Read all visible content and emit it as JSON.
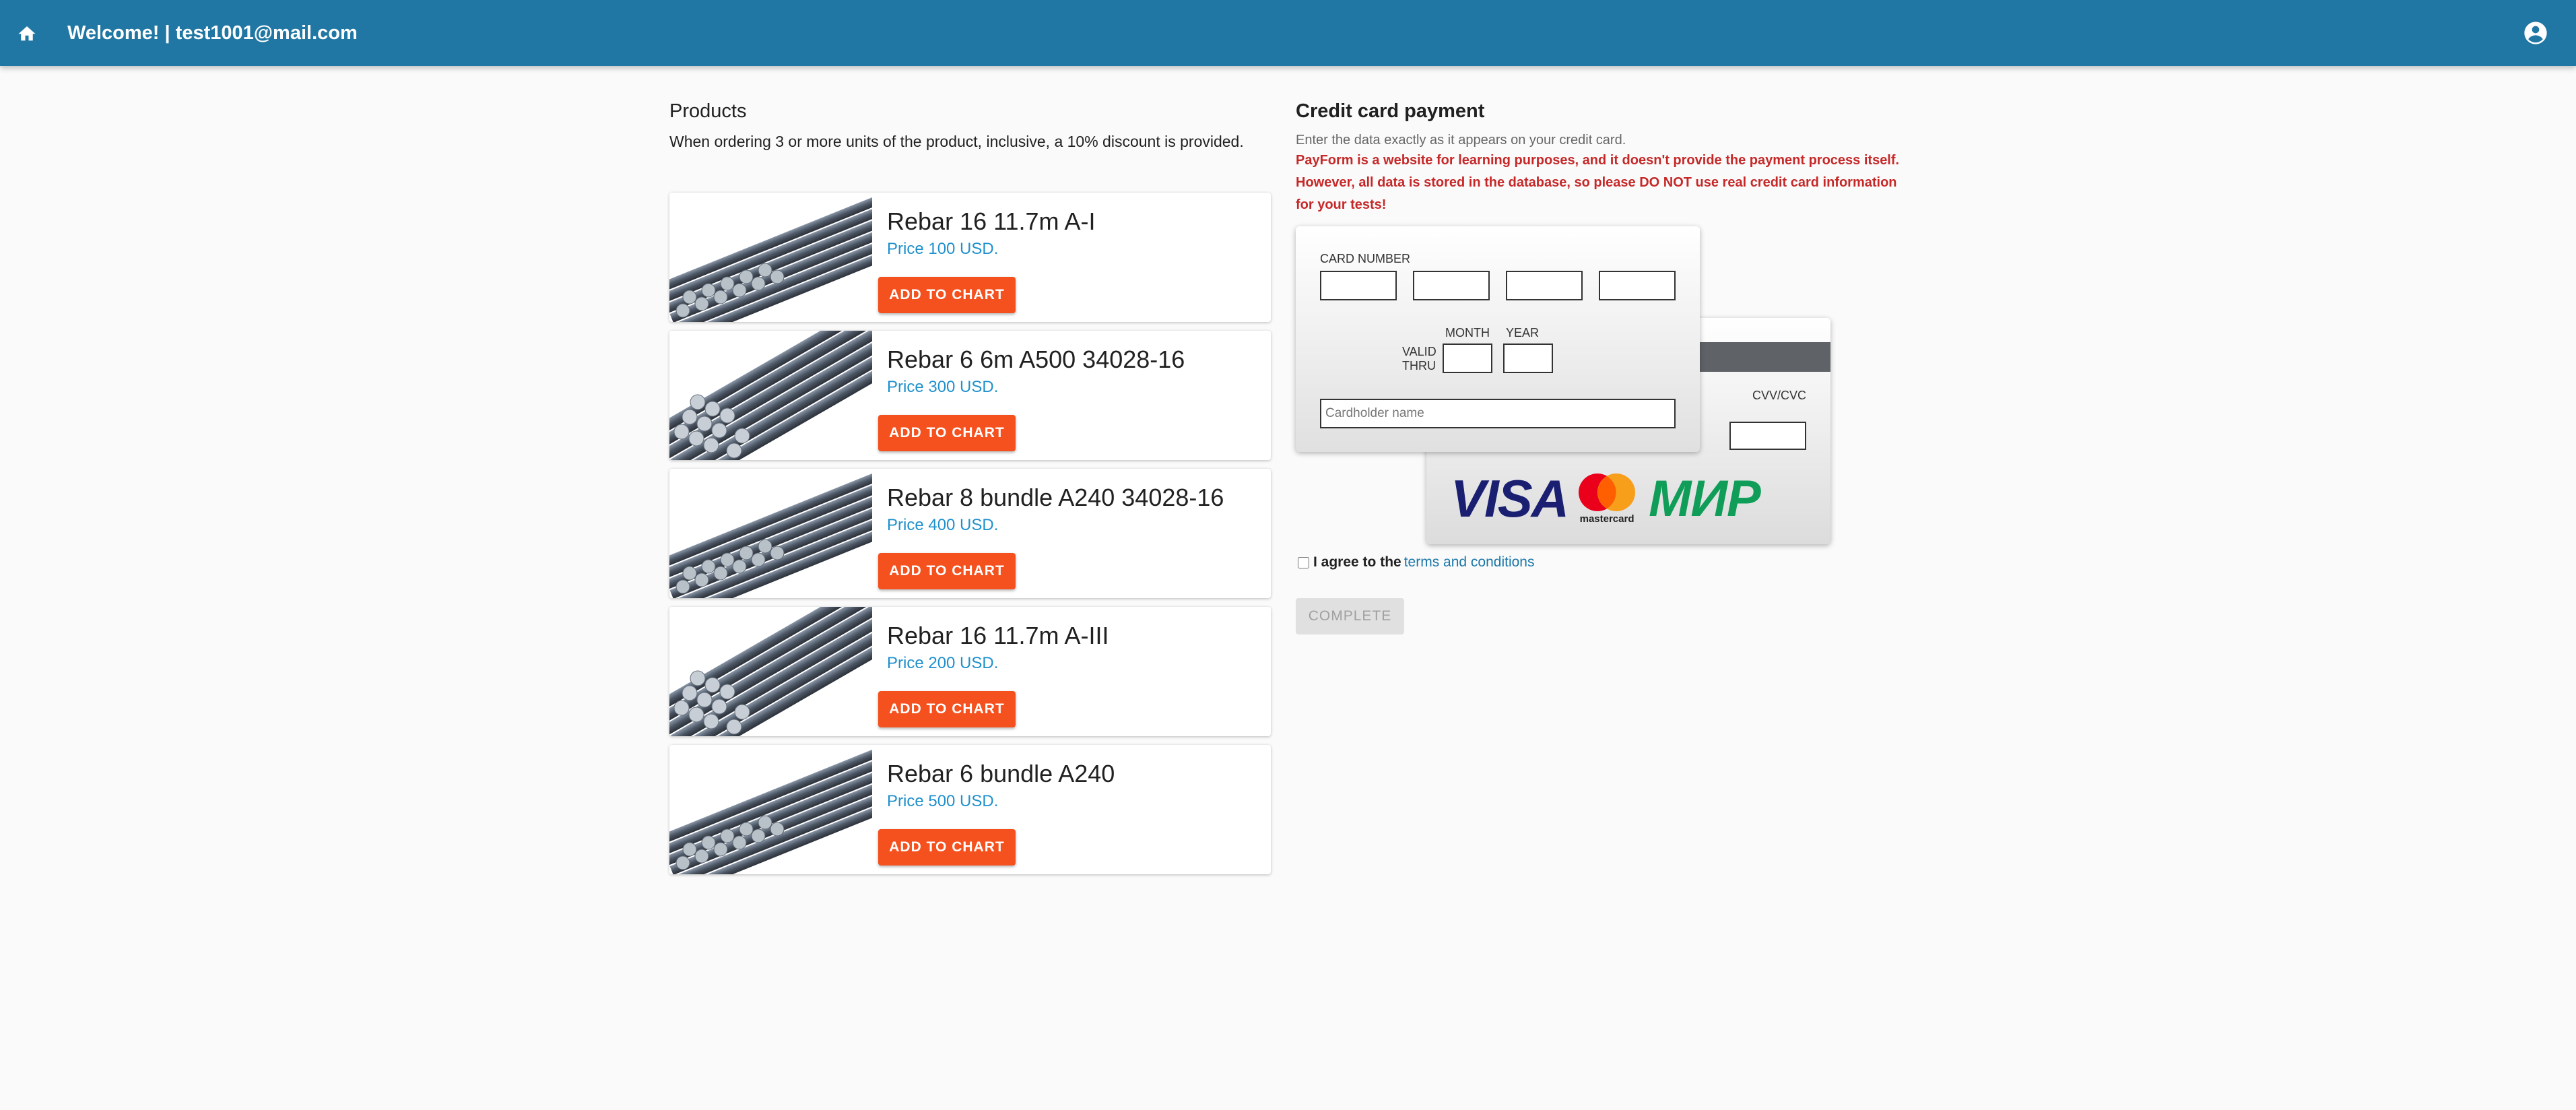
{
  "header": {
    "title": "Welcome! | test1001@mail.com",
    "home_icon": "home-icon",
    "account_icon": "account-circle-icon",
    "color": "#2177a3"
  },
  "products": {
    "title": "Products",
    "discount_note": "When ordering 3 or more units of the product, inclusive, a 10% discount is provided.",
    "items": [
      {
        "name": "Rebar 16 11.7m A-I",
        "price": "Price 100 USD.",
        "button": "ADD TO CHART",
        "image": "rebar-bundle"
      },
      {
        "name": "Rebar 6 6m A500 34028-16",
        "price": "Price 300 USD.",
        "button": "ADD TO CHART",
        "image": "rebar-stack"
      },
      {
        "name": "Rebar 8 bundle A240 34028-16",
        "price": "Price 400 USD.",
        "button": "ADD TO CHART",
        "image": "rebar-bundle"
      },
      {
        "name": "Rebar 16 11.7m A-III",
        "price": "Price 200 USD.",
        "button": "ADD TO CHART",
        "image": "rebar-stack"
      },
      {
        "name": "Rebar 6 bundle A240",
        "price": "Price 500 USD.",
        "button": "ADD TO CHART",
        "image": "rebar-bundle"
      }
    ],
    "button_color": "#f4511e",
    "price_color": "#1e90cc"
  },
  "payment": {
    "title": "Credit card payment",
    "subtitle": "Enter the data exactly as it appears on your credit card.",
    "warning": "PayForm is a website for learning purposes, and it doesn't provide the payment process itself. However, all data is stored in the database, so please DO NOT use real credit card information for your tests!",
    "warning_color": "#c62828",
    "card_number_label": "CARD NUMBER",
    "month_label": "MONTH",
    "year_label": "YEAR",
    "valid_thru_label": "VALID THRU",
    "cardholder_placeholder": "Cardholder name",
    "cvv_label": "CVV/CVC",
    "logos": {
      "visa": "VISA",
      "mastercard": "mastercard",
      "mir": "МИР"
    },
    "agree_text": "I agree to the",
    "terms_link": "terms and conditions",
    "complete_button": "COMPLETE"
  }
}
